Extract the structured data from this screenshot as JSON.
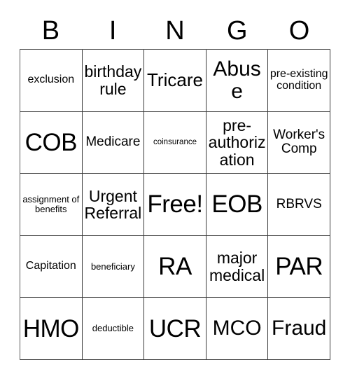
{
  "card": {
    "title": "BINGO Card",
    "header_letters": [
      "B",
      "I",
      "N",
      "G",
      "O"
    ],
    "columns": 5,
    "rows": 5,
    "colors": {
      "background": "#ffffff",
      "grid_line": "#3a3a3a",
      "text": "#000000"
    },
    "cells": [
      {
        "text": "exclusion",
        "size": "s-xs"
      },
      {
        "text": "birthday rule",
        "size": "s-md"
      },
      {
        "text": "Tricare",
        "size": "s-lg"
      },
      {
        "text": "Abuse",
        "size": "s-xl"
      },
      {
        "text": "pre-existing condition",
        "size": "s-xs"
      },
      {
        "text": "COB",
        "size": "s-xxl"
      },
      {
        "text": "Medicare",
        "size": "s-sm"
      },
      {
        "text": "coinsurance",
        "size": "s-tiny"
      },
      {
        "text": "pre-authorization",
        "size": "s-md"
      },
      {
        "text": "Worker's Comp",
        "size": "s-sm"
      },
      {
        "text": "assignment of benefits",
        "size": "s-xxs"
      },
      {
        "text": "Urgent Referral",
        "size": "s-md"
      },
      {
        "text": "Free!",
        "size": "s-xxl"
      },
      {
        "text": "EOB",
        "size": "s-xxl"
      },
      {
        "text": "RBRVS",
        "size": "s-sm"
      },
      {
        "text": "Capitation",
        "size": "s-xs"
      },
      {
        "text": "beneficiary",
        "size": "s-xxs"
      },
      {
        "text": "RA",
        "size": "s-xxl"
      },
      {
        "text": "major medical",
        "size": "s-md"
      },
      {
        "text": "PAR",
        "size": "s-xxl"
      },
      {
        "text": "HMO",
        "size": "s-xxl"
      },
      {
        "text": "deductible",
        "size": "s-xxs"
      },
      {
        "text": "UCR",
        "size": "s-xxl"
      },
      {
        "text": "MCO",
        "size": "s-xl"
      },
      {
        "text": "Fraud",
        "size": "s-xl"
      }
    ]
  }
}
